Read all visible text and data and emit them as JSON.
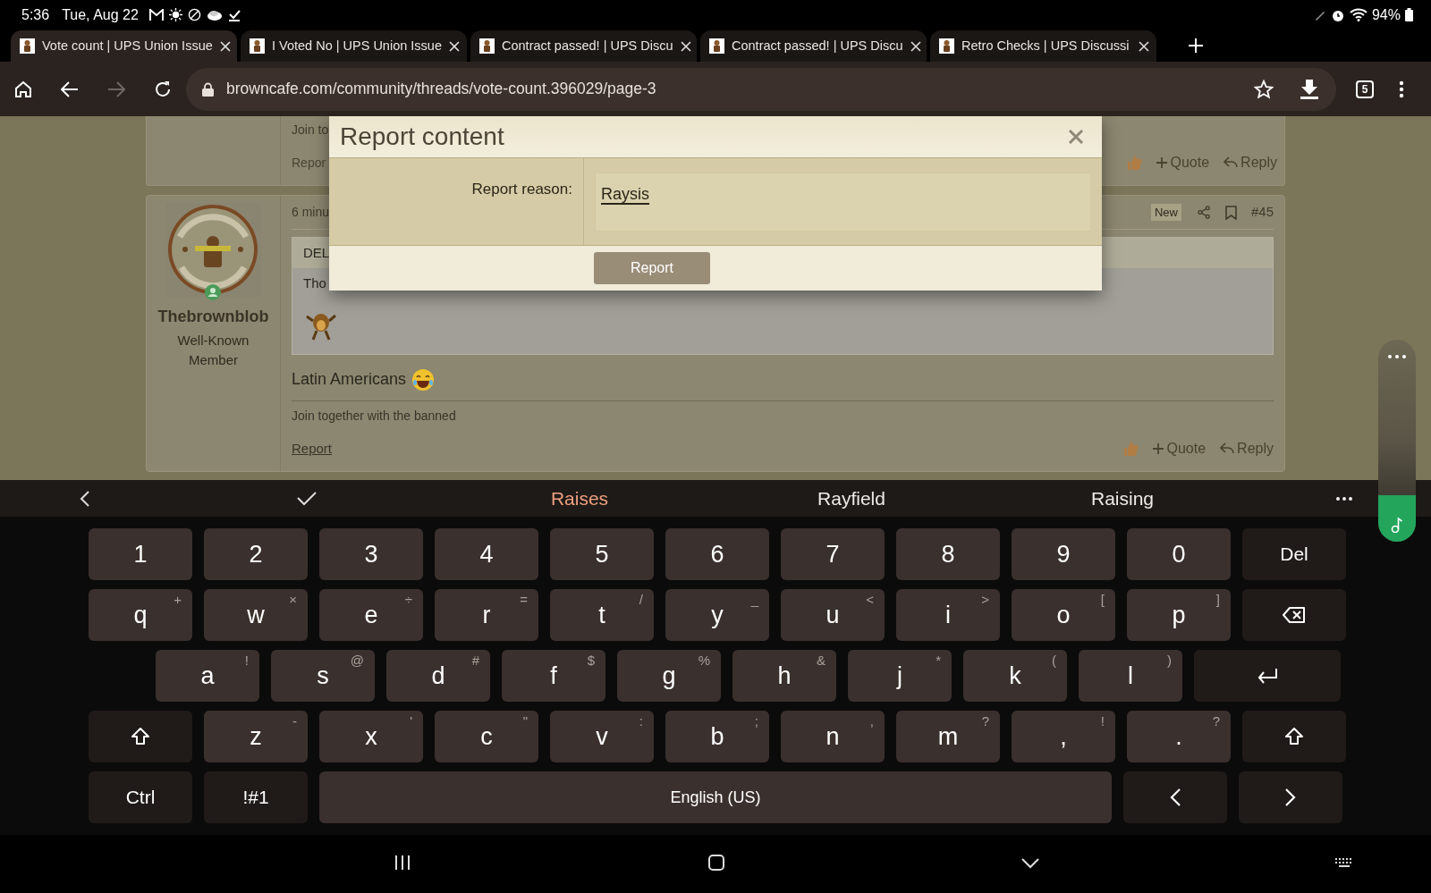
{
  "status_bar": {
    "time": "5:36",
    "date": "Tue, Aug 22",
    "battery": "94%"
  },
  "tabs": [
    {
      "title": "Vote count | UPS Union Issue",
      "selected": true
    },
    {
      "title": "I Voted No | UPS Union Issue",
      "selected": false
    },
    {
      "title": "Contract passed! | UPS Discu",
      "selected": false
    },
    {
      "title": "Contract passed! | UPS Discu",
      "selected": false
    },
    {
      "title": "Retro Checks | UPS Discussi",
      "selected": false
    }
  ],
  "toolbar": {
    "forward_disabled": true,
    "url": "browncafe.com/community/threads/vote-count.396029/page-3",
    "tab_count": "5"
  },
  "page": {
    "previous_post": {
      "text": "Join to",
      "report_link": "Repor",
      "quote": "Quote",
      "reply": "Reply"
    },
    "post": {
      "username": "Thebrownblob",
      "user_title": "Well-Known Member",
      "time": "6 minu",
      "badge": "New",
      "number": "#45",
      "quote_header": "DEL",
      "quote_text": "Tho",
      "message": "Latin Americans",
      "signature": "Join together with the banned",
      "report_link": "Report",
      "quote": "Quote",
      "reply": "Reply"
    },
    "dialog": {
      "title": "Report content",
      "field_label": "Report reason:",
      "field_value": "Raysis",
      "button": "Report"
    }
  },
  "keyboard": {
    "suggestions": [
      {
        "text": "Raises",
        "selected": true
      },
      {
        "text": "Rayfield",
        "selected": false
      },
      {
        "text": "Raising",
        "selected": false
      }
    ],
    "rows": [
      [
        {
          "label": "1",
          "kind": "char"
        },
        {
          "label": "2",
          "kind": "char"
        },
        {
          "label": "3",
          "kind": "char"
        },
        {
          "label": "4",
          "kind": "char"
        },
        {
          "label": "5",
          "kind": "char"
        },
        {
          "label": "6",
          "kind": "char"
        },
        {
          "label": "7",
          "kind": "char"
        },
        {
          "label": "8",
          "kind": "char"
        },
        {
          "label": "9",
          "kind": "char"
        },
        {
          "label": "0",
          "kind": "char"
        },
        {
          "label": "Del",
          "kind": "func"
        }
      ],
      [
        {
          "label": "q",
          "alt": "+",
          "kind": "char"
        },
        {
          "label": "w",
          "alt": "×",
          "kind": "char"
        },
        {
          "label": "e",
          "alt": "÷",
          "kind": "char"
        },
        {
          "label": "r",
          "alt": "=",
          "kind": "char"
        },
        {
          "label": "t",
          "alt": "/",
          "kind": "char"
        },
        {
          "label": "y",
          "alt": "_",
          "kind": "char"
        },
        {
          "label": "u",
          "alt": "<",
          "kind": "char"
        },
        {
          "label": "i",
          "alt": ">",
          "kind": "char"
        },
        {
          "label": "o",
          "alt": "[",
          "kind": "char"
        },
        {
          "label": "p",
          "alt": "]",
          "kind": "char"
        },
        {
          "kind": "backspace"
        }
      ],
      [
        {
          "label": "a",
          "alt": "!",
          "kind": "char"
        },
        {
          "label": "s",
          "alt": "@",
          "kind": "char"
        },
        {
          "label": "d",
          "alt": "#",
          "kind": "char"
        },
        {
          "label": "f",
          "alt": "$",
          "kind": "char"
        },
        {
          "label": "g",
          "alt": "%",
          "kind": "char"
        },
        {
          "label": "h",
          "alt": "&",
          "kind": "char"
        },
        {
          "label": "j",
          "alt": "*",
          "kind": "char"
        },
        {
          "label": "k",
          "alt": "(",
          "kind": "char"
        },
        {
          "label": "l",
          "alt": ")",
          "kind": "char"
        },
        {
          "kind": "enter"
        }
      ],
      [
        {
          "kind": "shift"
        },
        {
          "label": "z",
          "alt": "-",
          "kind": "char"
        },
        {
          "label": "x",
          "alt": "'",
          "kind": "char"
        },
        {
          "label": "c",
          "alt": "\"",
          "kind": "char"
        },
        {
          "label": "v",
          "alt": ":",
          "kind": "char"
        },
        {
          "label": "b",
          "alt": ";",
          "kind": "char"
        },
        {
          "label": "n",
          "alt": ",",
          "kind": "char"
        },
        {
          "label": "m",
          "alt": "?",
          "kind": "char"
        },
        {
          "label": ",",
          "alt": "!",
          "kind": "char"
        },
        {
          "label": ".",
          "alt": "?",
          "kind": "char"
        },
        {
          "kind": "shift"
        }
      ]
    ],
    "bottom_row": [
      {
        "label": "Ctrl",
        "kind": "func"
      },
      {
        "label": "!#1",
        "kind": "func"
      },
      {
        "label": "English (US)",
        "kind": "space"
      },
      {
        "kind": "left"
      },
      {
        "kind": "right"
      }
    ]
  }
}
